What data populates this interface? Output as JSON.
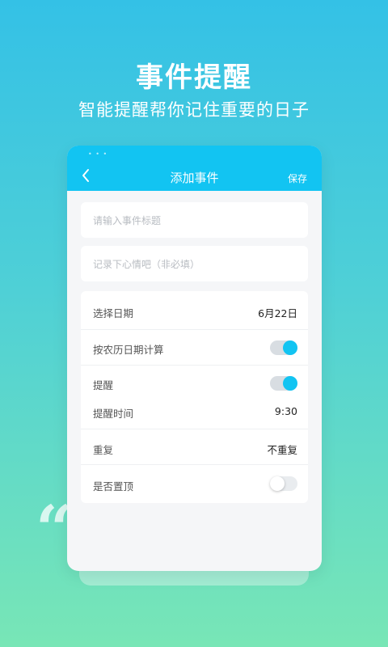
{
  "hero": {
    "title": "事件提醒",
    "subtitle": "智能提醒帮你记住重要的日子"
  },
  "decor": {
    "quote_mark": "“"
  },
  "app": {
    "title": "添加事件",
    "back_icon": "chevron-left-icon",
    "save_label": "保存",
    "accent_color": "#12c4f2"
  },
  "form": {
    "title_placeholder": "请输入事件标题",
    "note_placeholder": "记录下心情吧（非必填）"
  },
  "settings": {
    "date_label": "选择日期",
    "date_value": "6月22日",
    "lunar_label": "按农历日期计算",
    "lunar_on": true,
    "remind_label": "提醒",
    "remind_on": true,
    "remind_time_label": "提醒时间",
    "remind_time_value": "9:30",
    "repeat_label": "重复",
    "repeat_value": "不重复",
    "pin_label": "是否置顶",
    "pin_on": false
  }
}
